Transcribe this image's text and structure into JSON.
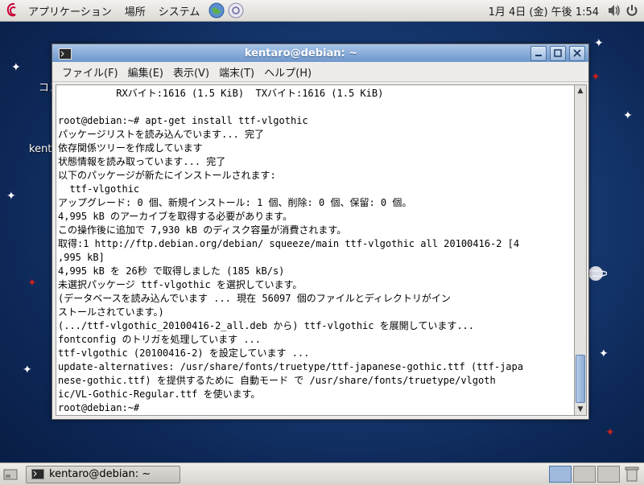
{
  "top_panel": {
    "menus": [
      "アプリケーション",
      "場所",
      "システム"
    ],
    "clock": "1月 4日 (金) 午後 1:54"
  },
  "desktop": {
    "icon_labels": [
      "コン",
      "kenta"
    ]
  },
  "window": {
    "title": "kentaro@debian: ~",
    "menus": [
      "ファイル(F)",
      "編集(E)",
      "表示(V)",
      "端末(T)",
      "ヘルプ(H)"
    ],
    "terminal_lines": [
      "          RXバイト:1616 (1.5 KiB)  TXバイト:1616 (1.5 KiB)",
      "",
      "root@debian:~# apt-get install ttf-vlgothic",
      "パッケージリストを読み込んでいます... 完了",
      "依存関係ツリーを作成しています",
      "状態情報を読み取っています... 完了",
      "以下のパッケージが新たにインストールされます:",
      "  ttf-vlgothic",
      "アップグレード: 0 個、新規インストール: 1 個、削除: 0 個、保留: 0 個。",
      "4,995 kB のアーカイブを取得する必要があります。",
      "この操作後に追加で 7,930 kB のディスク容量が消費されます。",
      "取得:1 http://ftp.debian.org/debian/ squeeze/main ttf-vlgothic all 20100416-2 [4",
      ",995 kB]",
      "4,995 kB を 26秒 で取得しました (185 kB/s)",
      "未選択パッケージ ttf-vlgothic を選択しています。",
      "(データベースを読み込んでいます ... 現在 56097 個のファイルとディレクトリがイン",
      "ストールされています。)",
      "(.../ttf-vlgothic_20100416-2_all.deb から) ttf-vlgothic を展開しています...",
      "fontconfig のトリガを処理しています ...",
      "ttf-vlgothic (20100416-2) を設定しています ...",
      "update-alternatives: /usr/share/fonts/truetype/ttf-japanese-gothic.ttf (ttf-japa",
      "nese-gothic.ttf) を提供するために 自動モード で /usr/share/fonts/truetype/vlgoth",
      "ic/VL-Gothic-Regular.ttf を使います。",
      "root@debian:~# "
    ]
  },
  "taskbar": {
    "task_label": "kentaro@debian: ~"
  },
  "colors": {
    "desktop_bg": "#1a3f7a",
    "titlebar": "#6d97cc",
    "terminal_bg": "#ffffff"
  },
  "icons": [
    "debian-swirl-icon",
    "web-browser-icon",
    "mail-icon",
    "volume-icon",
    "power-icon",
    "terminal-icon",
    "show-desktop-icon",
    "trash-icon"
  ]
}
